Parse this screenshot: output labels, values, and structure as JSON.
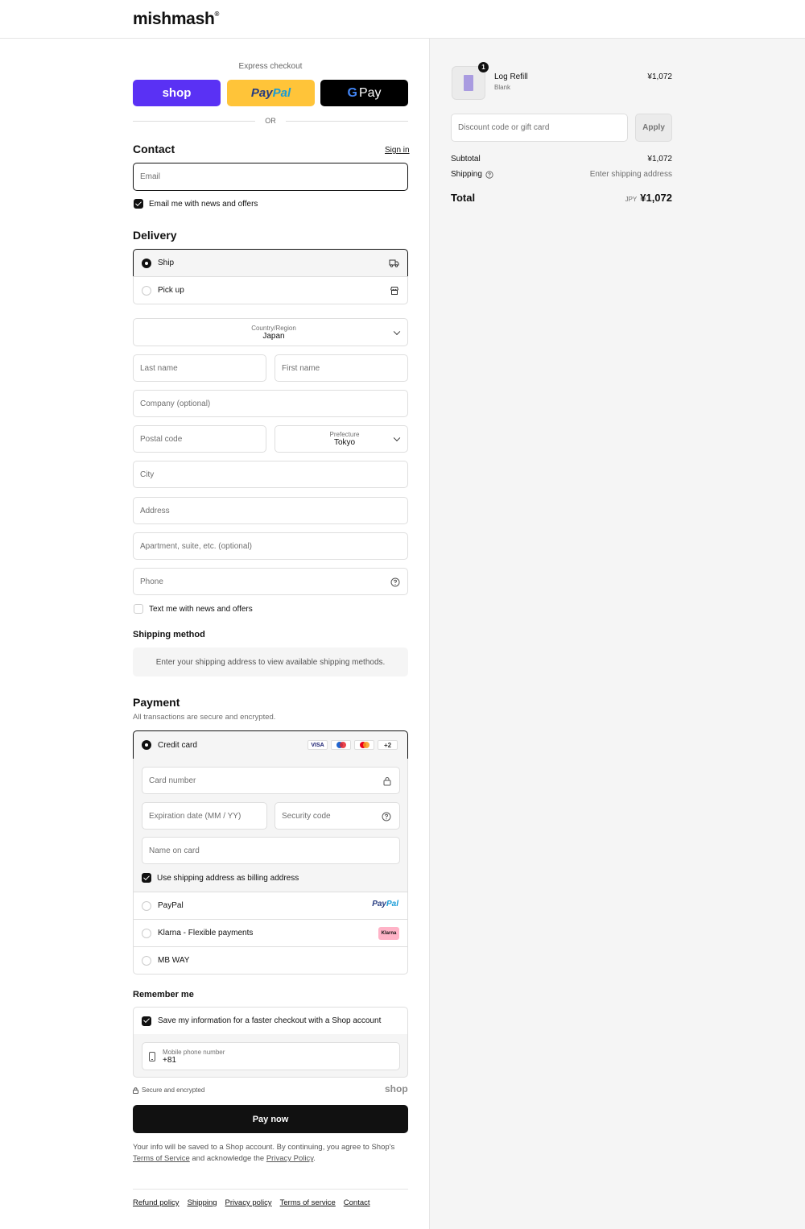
{
  "brand": {
    "name": "mishmash",
    "mark": "®"
  },
  "express": {
    "label": "Express checkout",
    "shop": "shop",
    "paypal_a": "Pay",
    "paypal_b": "Pal",
    "gpay_g": "G",
    "gpay_text": "Pay",
    "or": "OR"
  },
  "contact": {
    "title": "Contact",
    "signin": "Sign in",
    "email_placeholder": "Email",
    "news_label": "Email me with news and offers"
  },
  "delivery": {
    "title": "Delivery",
    "ship": "Ship",
    "pickup": "Pick up",
    "country_label": "Country/Region",
    "country_value": "Japan",
    "last_name": "Last name",
    "first_name": "First name",
    "company": "Company (optional)",
    "postal": "Postal code",
    "prefecture_label": "Prefecture",
    "prefecture_value": "Tokyo",
    "city": "City",
    "address": "Address",
    "apartment": "Apartment, suite, etc. (optional)",
    "phone": "Phone",
    "text_news": "Text me with news and offers"
  },
  "shipping_method": {
    "title": "Shipping method",
    "info": "Enter your shipping address to view available shipping methods."
  },
  "payment": {
    "title": "Payment",
    "subtitle": "All transactions are secure and encrypted.",
    "credit_card": "Credit card",
    "visa": "VISA",
    "more": "+2",
    "card_number": "Card number",
    "expiration": "Expiration date (MM / YY)",
    "security": "Security code",
    "name_on_card": "Name on card",
    "billing_same": "Use shipping address as billing address",
    "paypal": "PayPal",
    "paypal_logo_a": "Pay",
    "paypal_logo_b": "Pal",
    "klarna": "Klarna - Flexible payments",
    "klarna_logo": "Klarna",
    "mbway": "MB WAY"
  },
  "remember": {
    "title": "Remember me",
    "save_label": "Save my information for a faster checkout with a Shop account",
    "mobile_label": "Mobile phone number",
    "mobile_value": "+81",
    "secure": "Secure and encrypted",
    "shop_logo": "shop"
  },
  "pay_now": "Pay now",
  "legal": {
    "text1": "Your info will be saved to a Shop account. By continuing, you agree to Shop's",
    "tos": "Terms of Service",
    "text2": " and acknowledge the ",
    "privacy": "Privacy Policy",
    "text3": "."
  },
  "footer": [
    "Refund policy",
    "Shipping",
    "Privacy policy",
    "Terms of service",
    "Contact"
  ],
  "summary": {
    "item_name": "Log Refill",
    "item_variant": "Blank",
    "item_qty": "1",
    "item_price": "¥1,072",
    "discount_placeholder": "Discount code or gift card",
    "apply": "Apply",
    "subtotal_label": "Subtotal",
    "subtotal_value": "¥1,072",
    "shipping_label": "Shipping",
    "shipping_value": "Enter shipping address",
    "total_label": "Total",
    "currency": "JPY",
    "total_value": "¥1,072"
  },
  "colors": {
    "shop": "#5a31f4",
    "paypal": "#ffc439",
    "gpay": "#000000",
    "accent": "#111111",
    "klarna": "#ffb3c7"
  }
}
